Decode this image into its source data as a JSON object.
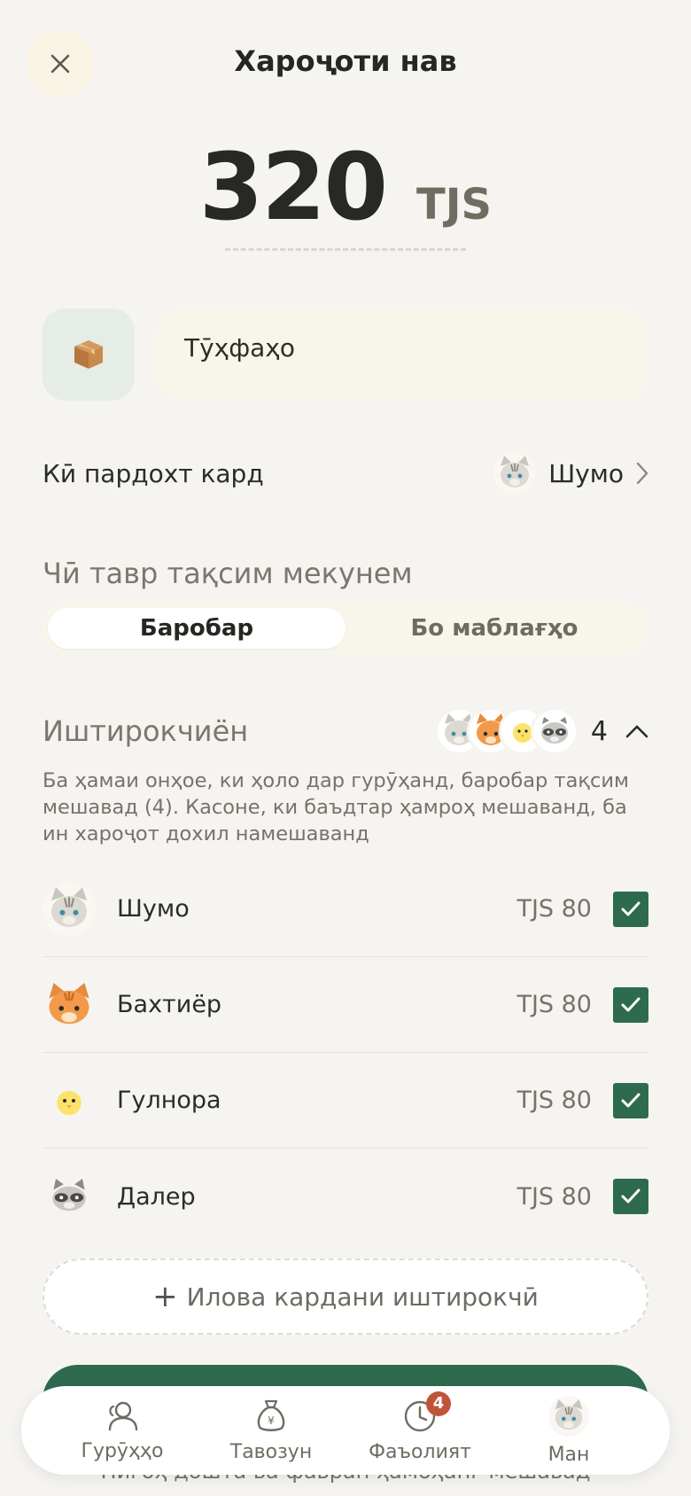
{
  "header": {
    "title": "Хароҷоти нав"
  },
  "amount": {
    "value": "320",
    "currency": "TJS"
  },
  "category": {
    "icon": "package-icon"
  },
  "description": {
    "value": "Тӯҳфаҳо"
  },
  "paid_by": {
    "label": "Кӣ пардохт кард",
    "payer_name": "Шумо"
  },
  "split": {
    "label": "Чӣ тавр тақсим мекунем",
    "options": [
      "Баробар",
      "Бо маблағҳо"
    ],
    "selected": "Баробар"
  },
  "participants": {
    "label": "Иштирокчиён",
    "count": "4",
    "info": "Ба ҳамаи онҳое, ки ҳоло дар гурӯҳанд, баробар тақсим мешавад (4). Касоне, ки баъдтар ҳамроҳ мешаванд, ба ин хароҷот дохил намешаванд",
    "members": [
      {
        "name": "Шумо",
        "amount": "TJS 80",
        "avatar": "gray-cat",
        "checked": true
      },
      {
        "name": "Бахтиёр",
        "amount": "TJS 80",
        "avatar": "orange-cat",
        "checked": true
      },
      {
        "name": "Гулнора",
        "amount": "TJS 80",
        "avatar": "chick",
        "checked": true
      },
      {
        "name": "Далер",
        "amount": "TJS 80",
        "avatar": "raccoon",
        "checked": true
      }
    ],
    "add_label": "Илова кардани иштирокчӣ"
  },
  "footer_note": "Пигоҳ дошта ва фавран ҳамоҳанг мешавад",
  "tabbar": {
    "tabs": [
      {
        "label": "Гурӯҳҳо",
        "icon": "people-icon"
      },
      {
        "label": "Тавозун",
        "icon": "money-bag-icon"
      },
      {
        "label": "Фаъолият",
        "icon": "clock-icon",
        "badge": "4"
      },
      {
        "label": "Ман",
        "icon": "avatar"
      }
    ]
  },
  "colors": {
    "accent": "#2e6b4e",
    "badge": "#c0543b",
    "background": "#f5f4f0"
  }
}
